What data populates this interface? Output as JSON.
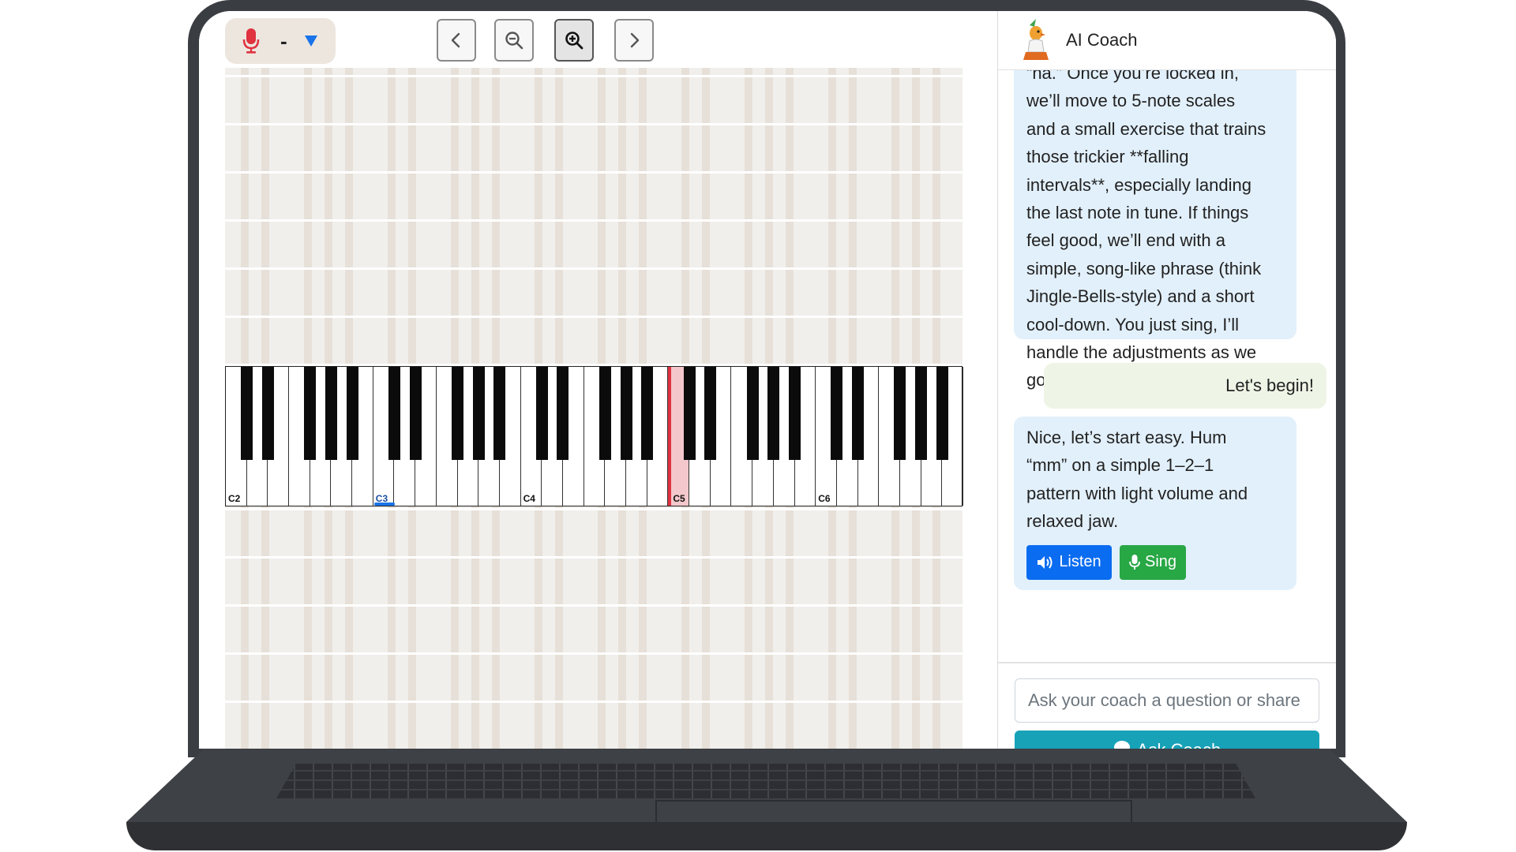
{
  "toolbar": {
    "pitch_readout": "-",
    "buttons": [
      "previous",
      "zoom-out",
      "zoom-in",
      "next"
    ]
  },
  "keyboard": {
    "octave_labels": [
      "C2",
      "C3",
      "C4",
      "C5",
      "C6"
    ],
    "highlighted_key": "C5",
    "selected_key": "C3",
    "colors": {
      "highlight": "#f3c7cb",
      "marker": "#e0323f",
      "selected": "#1a73e8"
    }
  },
  "chat": {
    "title": "AI Coach",
    "messages": [
      {
        "role": "coach",
        "lines": [
          "“ha.” Once you’re locked in,",
          "we’ll move to 5-note scales",
          "and a small exercise that trains",
          "those trickier **falling",
          "intervals**, especially landing",
          "the last note in tune. If things",
          "feel good, we’ll end with a",
          "simple, song-like phrase (think",
          "Jingle-Bells-style) and a short",
          "cool-down. You just sing, I’ll",
          "handle the adjustments as we",
          "go."
        ]
      },
      {
        "role": "user",
        "text": "Let's begin!"
      },
      {
        "role": "coach",
        "lines": [
          "Nice, let’s start easy. Hum",
          "“mm” on a simple 1–2–1",
          "pattern with light volume and",
          "relaxed jaw."
        ],
        "listen_label": "Listen",
        "sing_label": "Sing"
      }
    ],
    "input_placeholder": "Ask your coach a question or share",
    "ask_button_label": "Ask Coach",
    "colors": {
      "coach_bubble": "#e2f0fb",
      "user_bubble": "#eef5e6",
      "listen": "#0a6cf0",
      "sing": "#28a745",
      "ask": "#17a2b8"
    }
  }
}
